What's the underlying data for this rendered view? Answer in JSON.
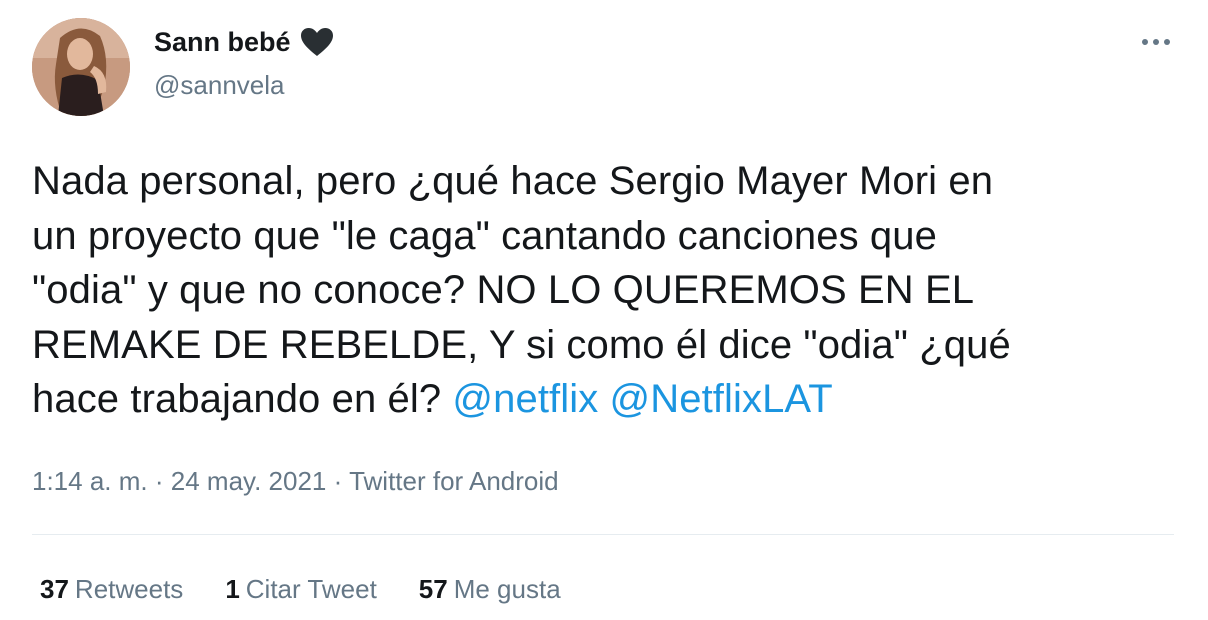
{
  "user": {
    "display_name": "Sann bebé",
    "handle": "@sannvela",
    "name_icon": "black-heart-icon"
  },
  "tweet": {
    "lines": [
      "Nada personal, pero ¿qué hace Sergio Mayer Mori en",
      "un proyecto que \"le caga\" cantando canciones que",
      "\"odia\" y que no conoce? NO LO QUEREMOS EN EL",
      "REMAKE DE REBELDE, Y si como él dice \"odia\" ¿qué"
    ],
    "last_line_text": "hace trabajando en él?",
    "mentions": [
      "@netflix",
      "@NetflixLAT"
    ]
  },
  "meta": {
    "time": "1:14 a. m.",
    "separator": "·",
    "date": "24 may. 2021",
    "source": "Twitter for Android"
  },
  "stats": {
    "retweets_count": "37",
    "retweets_label": "Retweets",
    "quotes_count": "1",
    "quotes_label": "Citar Tweet",
    "likes_count": "57",
    "likes_label": "Me gusta"
  },
  "colors": {
    "text": "#14171a",
    "secondary": "#657786",
    "link": "#1b95e0",
    "divider": "#e6ecf0"
  }
}
